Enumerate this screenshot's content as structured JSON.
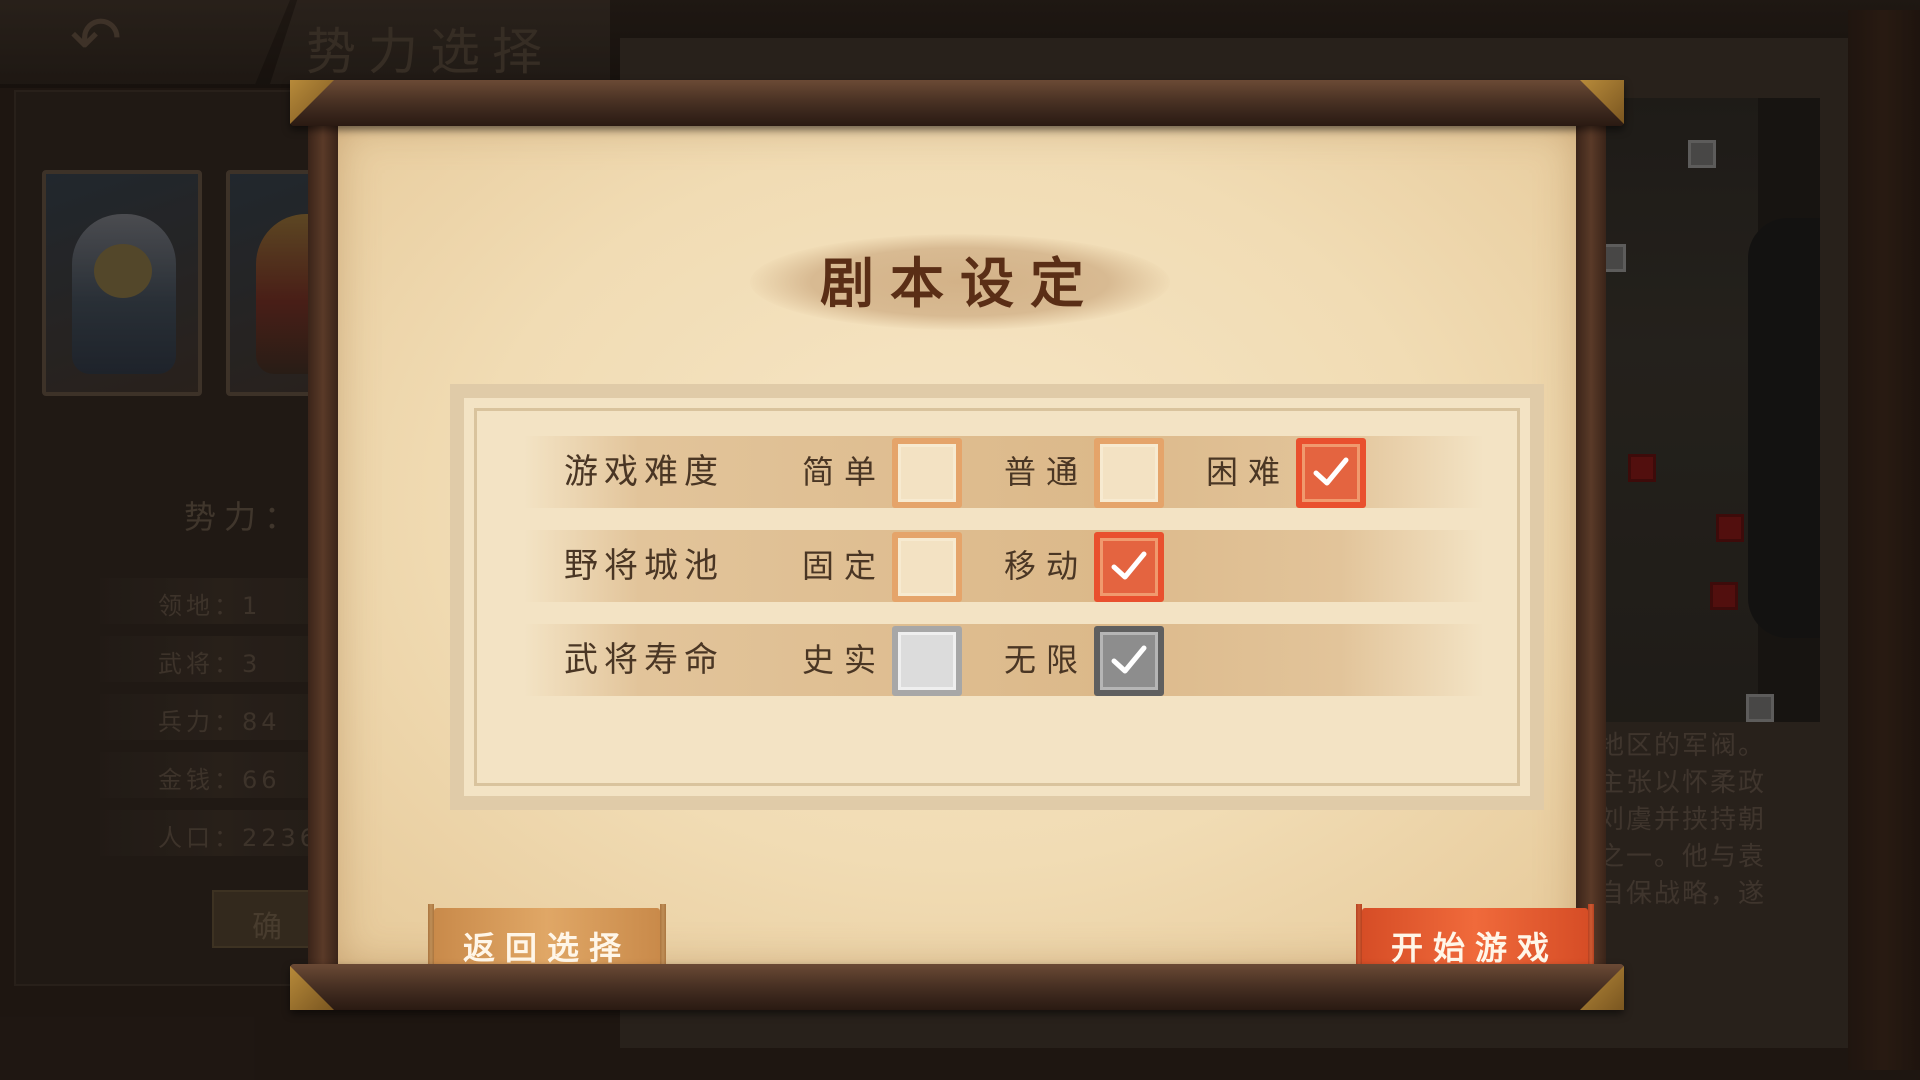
{
  "background": {
    "page_title": "势力选择",
    "faction_label": "势力：",
    "stats": [
      "领地：1",
      "武将：3",
      "兵力：84",
      "金钱：66",
      "人口：2236"
    ],
    "confirm_label": "确",
    "description_lines": [
      "地区的军阀。",
      "主张以怀柔政",
      "刘虞并挟持朝",
      "之一。他与袁",
      "自保战略，遂"
    ]
  },
  "dialog": {
    "title": "剧本设定",
    "rows": [
      {
        "label": "游戏难度",
        "options": [
          {
            "label": "简单",
            "checked": false
          },
          {
            "label": "普通",
            "checked": false
          },
          {
            "label": "困难",
            "checked": true
          }
        ]
      },
      {
        "label": "野将城池",
        "options": [
          {
            "label": "固定",
            "checked": false
          },
          {
            "label": "移动",
            "checked": true
          }
        ]
      },
      {
        "label": "武将寿命",
        "options": [
          {
            "label": "史实",
            "checked": false
          },
          {
            "label": "无限",
            "checked": true
          }
        ]
      }
    ],
    "back_button": "返回选择",
    "start_button": "开始游戏"
  },
  "colors": {
    "accent_orange": "#e9502e",
    "checkbox_gray": "#5f5f5f",
    "parchment": "#f1dcb4",
    "title_text": "#5a2e16"
  }
}
